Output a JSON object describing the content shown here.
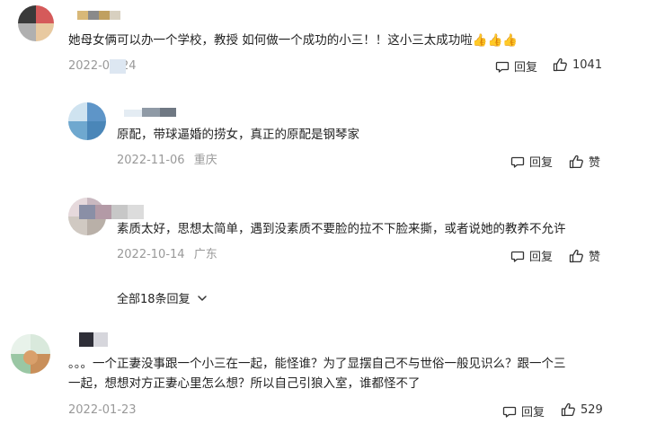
{
  "comments": [
    {
      "text": "她母女俩可以办一个学校，教授 如何做一个成功的小三！！这小三太成功啦👍👍👍",
      "date": "2022-01-24",
      "reply_label": "回复",
      "likes": "1041"
    },
    {
      "text": "原配，带球逼婚的捞女，真正的原配是钢琴家",
      "date": "2022-11-06",
      "location": "重庆",
      "reply_label": "回复",
      "like_label": "赞"
    },
    {
      "text": "素质太好，思想太简单，遇到没素质不要脸的拉不下脸来撕，或者说她的教养不允许",
      "date": "2022-10-14",
      "location": "广东",
      "reply_label": "回复",
      "like_label": "赞"
    },
    {
      "text_line1": "。。。一个正妻没事跟一个小三在一起，能怪谁？为了显摆自己不与世俗一般见识么？跟一个三",
      "text_line2": "一起，想想对方正妻心里怎么想？所以自己引狼入室，谁都怪不了",
      "date": "2022-01-23",
      "reply_label": "回复",
      "likes": "529"
    }
  ],
  "expand_replies_label": "全部18条回复",
  "icons": {
    "reply": "comment-bubble-icon",
    "like": "thumbs-up-icon",
    "expand": "chevron-down-icon"
  },
  "colors": {
    "text": "#222222",
    "meta": "#999999",
    "icon": "#333333"
  }
}
